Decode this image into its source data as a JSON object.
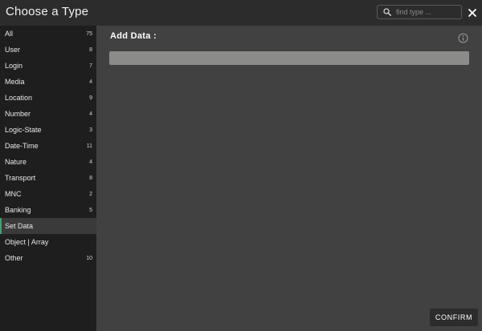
{
  "window": {
    "title": "Choose a Type",
    "close_icon": "close-icon"
  },
  "search": {
    "placeholder": "find type ...",
    "value": "",
    "icon": "search-icon"
  },
  "sidebar": {
    "items": [
      {
        "label": "All",
        "count": "75"
      },
      {
        "label": "User",
        "count": "8"
      },
      {
        "label": "Login",
        "count": "7"
      },
      {
        "label": "Media",
        "count": "4"
      },
      {
        "label": "Location",
        "count": "9"
      },
      {
        "label": "Number",
        "count": "4"
      },
      {
        "label": "Logic-State",
        "count": "3"
      },
      {
        "label": "Date-Time",
        "count": "11"
      },
      {
        "label": "Nature",
        "count": "4"
      },
      {
        "label": "Transport",
        "count": "8"
      },
      {
        "label": "MNC",
        "count": "2"
      },
      {
        "label": "Banking",
        "count": "5"
      },
      {
        "label": "Set Data",
        "count": ""
      },
      {
        "label": "Object | Array",
        "count": ""
      },
      {
        "label": "Other",
        "count": "10"
      }
    ],
    "active_index": 12,
    "active_color": "#3aa56b"
  },
  "main": {
    "title": "Add Data  :",
    "info_icon": "info-icon"
  },
  "footer": {
    "confirm_label": "CONFIRM"
  }
}
